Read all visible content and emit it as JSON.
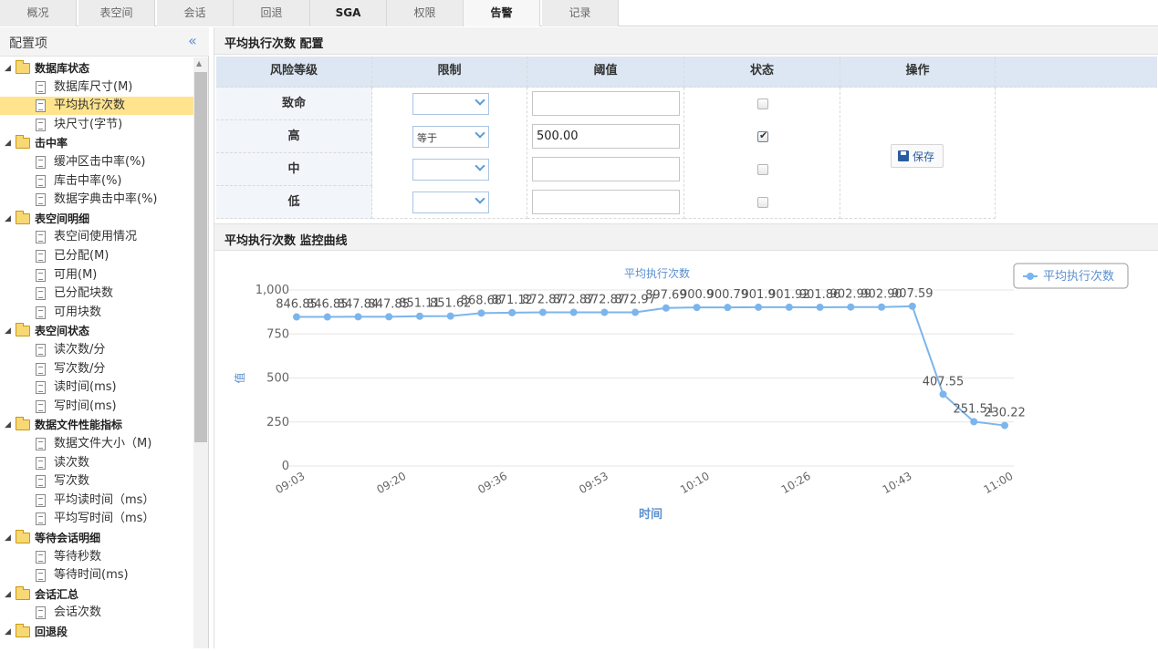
{
  "tabs": [
    {
      "label": "概况"
    },
    {
      "label": "表空间"
    },
    {
      "label": "会话"
    },
    {
      "label": "回退"
    },
    {
      "label": "SGA"
    },
    {
      "label": "权限"
    },
    {
      "label": "告警"
    },
    {
      "label": "记录"
    }
  ],
  "sidebar": {
    "title": "配置项",
    "collapse_icon": "«",
    "groups": [
      {
        "label": "数据库状态",
        "items": [
          "数据库尺寸(M)",
          "平均执行次数",
          "块尺寸(字节)"
        ]
      },
      {
        "label": "击中率",
        "items": [
          "缓冲区击中率(%)",
          "库击中率(%)",
          "数据字典击中率(%)"
        ]
      },
      {
        "label": "表空间明细",
        "items": [
          "表空间使用情况",
          "已分配(M)",
          "可用(M)",
          "已分配块数",
          "可用块数"
        ]
      },
      {
        "label": "表空间状态",
        "items": [
          "读次数/分",
          "写次数/分",
          "读时间(ms)",
          "写时间(ms)"
        ]
      },
      {
        "label": "数据文件性能指标",
        "items": [
          "数据文件大小（M)",
          "读次数",
          "写次数",
          "平均读时间（ms）",
          "平均写时间（ms）"
        ]
      },
      {
        "label": "等待会话明细",
        "items": [
          "等待秒数",
          "等待时间(ms)"
        ]
      },
      {
        "label": "会话汇总",
        "items": [
          "会话次数"
        ]
      },
      {
        "label": "回退段",
        "items": []
      }
    ],
    "selected_item": "平均执行次数"
  },
  "config": {
    "title": "平均执行次数 配置",
    "headers": [
      "风险等级",
      "限制",
      "阈值",
      "状态",
      "操作"
    ],
    "rows": [
      {
        "level": "致命",
        "limit": "",
        "threshold": "",
        "enabled": false
      },
      {
        "level": "高",
        "limit": "等于",
        "threshold": "500.00",
        "enabled": true
      },
      {
        "level": "中",
        "limit": "",
        "threshold": "",
        "enabled": false
      },
      {
        "level": "低",
        "limit": "",
        "threshold": "",
        "enabled": false
      }
    ],
    "save_label": "保存"
  },
  "monitor": {
    "title": "平均执行次数 监控曲线"
  },
  "chart_data": {
    "type": "line",
    "title": "平均执行次数",
    "xlabel": "时间",
    "ylabel": "值",
    "ylim": [
      0,
      1000
    ],
    "yticks": [
      "0",
      "250",
      "500",
      "750",
      "1,000"
    ],
    "xtick_labels": [
      "09:03",
      "09:20",
      "09:36",
      "09:53",
      "10:10",
      "10:26",
      "10:43",
      "11:00"
    ],
    "legend_position": "top-right",
    "series": [
      {
        "name": "平均执行次数",
        "color": "#7cb5ec",
        "values": [
          846.85,
          846.85,
          847.84,
          847.85,
          851.11,
          851.62,
          868.68,
          871.12,
          872.87,
          872.87,
          872.87,
          872.97,
          897.69,
          900.9,
          900.79,
          901.9,
          901.92,
          901.86,
          902.99,
          902.9,
          907.59,
          407.55,
          251.51,
          230.22
        ]
      }
    ],
    "data_labels": [
      "846.85",
      "846.85",
      "847.84",
      "847.85",
      "851.11",
      "851.62",
      "868.68",
      "871.12",
      "872.87",
      "872.87",
      "872.87",
      "872.97",
      "897.69",
      "900.9",
      "900.79",
      "901.9",
      "901.92",
      "901.86",
      "902.99",
      "902.90",
      "907.59",
      "407.55",
      "251.51",
      "230.22"
    ]
  }
}
